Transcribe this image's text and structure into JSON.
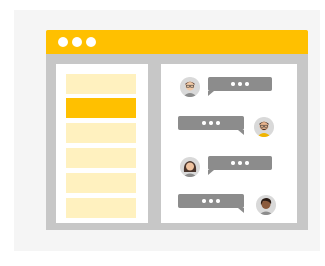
{
  "colors": {
    "accent": "#ffc000",
    "sidebar_item_light": "#fff1bf",
    "frame": "#c7c7c7",
    "bubble": "#8c8c8c"
  },
  "sidebar": {
    "items": [
      {
        "name": "item-1",
        "selected": false
      },
      {
        "name": "item-2",
        "selected": true
      },
      {
        "name": "item-3",
        "selected": false
      },
      {
        "name": "item-4",
        "selected": false
      },
      {
        "name": "item-5",
        "selected": false
      },
      {
        "name": "item-6",
        "selected": false
      }
    ]
  },
  "chat": {
    "messages": [
      {
        "side": "left",
        "avatar": "person-with-glasses-icon"
      },
      {
        "side": "right",
        "avatar": "person-with-beard-icon"
      },
      {
        "side": "left",
        "avatar": "person-long-hair-icon"
      },
      {
        "side": "right",
        "avatar": "person-dark-skin-icon"
      }
    ]
  }
}
